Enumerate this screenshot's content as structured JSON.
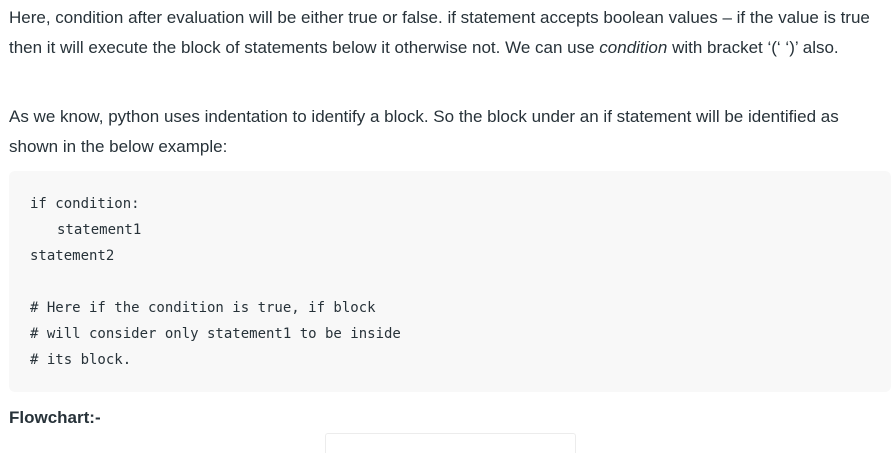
{
  "paragraph1": {
    "text_before": "Here, condition after evaluation will be either true or false. if statement accepts boolean values – if the value is true then it will execute the block of statements below it otherwise not. We can use ",
    "emphasis": "condition",
    "text_after": " with bracket ‘(‘ ‘)’ also."
  },
  "paragraph2": {
    "text": "As we know, python uses indentation to identify a block. So the block under an if statement will be identified as shown in the below example:"
  },
  "code": {
    "lines": [
      "if condition:",
      "statement1",
      "statement2",
      "",
      "# Here if the condition is true, if block",
      "# will consider only statement1 to be inside",
      "# its block."
    ]
  },
  "heading": {
    "text": "Flowchart:-"
  }
}
